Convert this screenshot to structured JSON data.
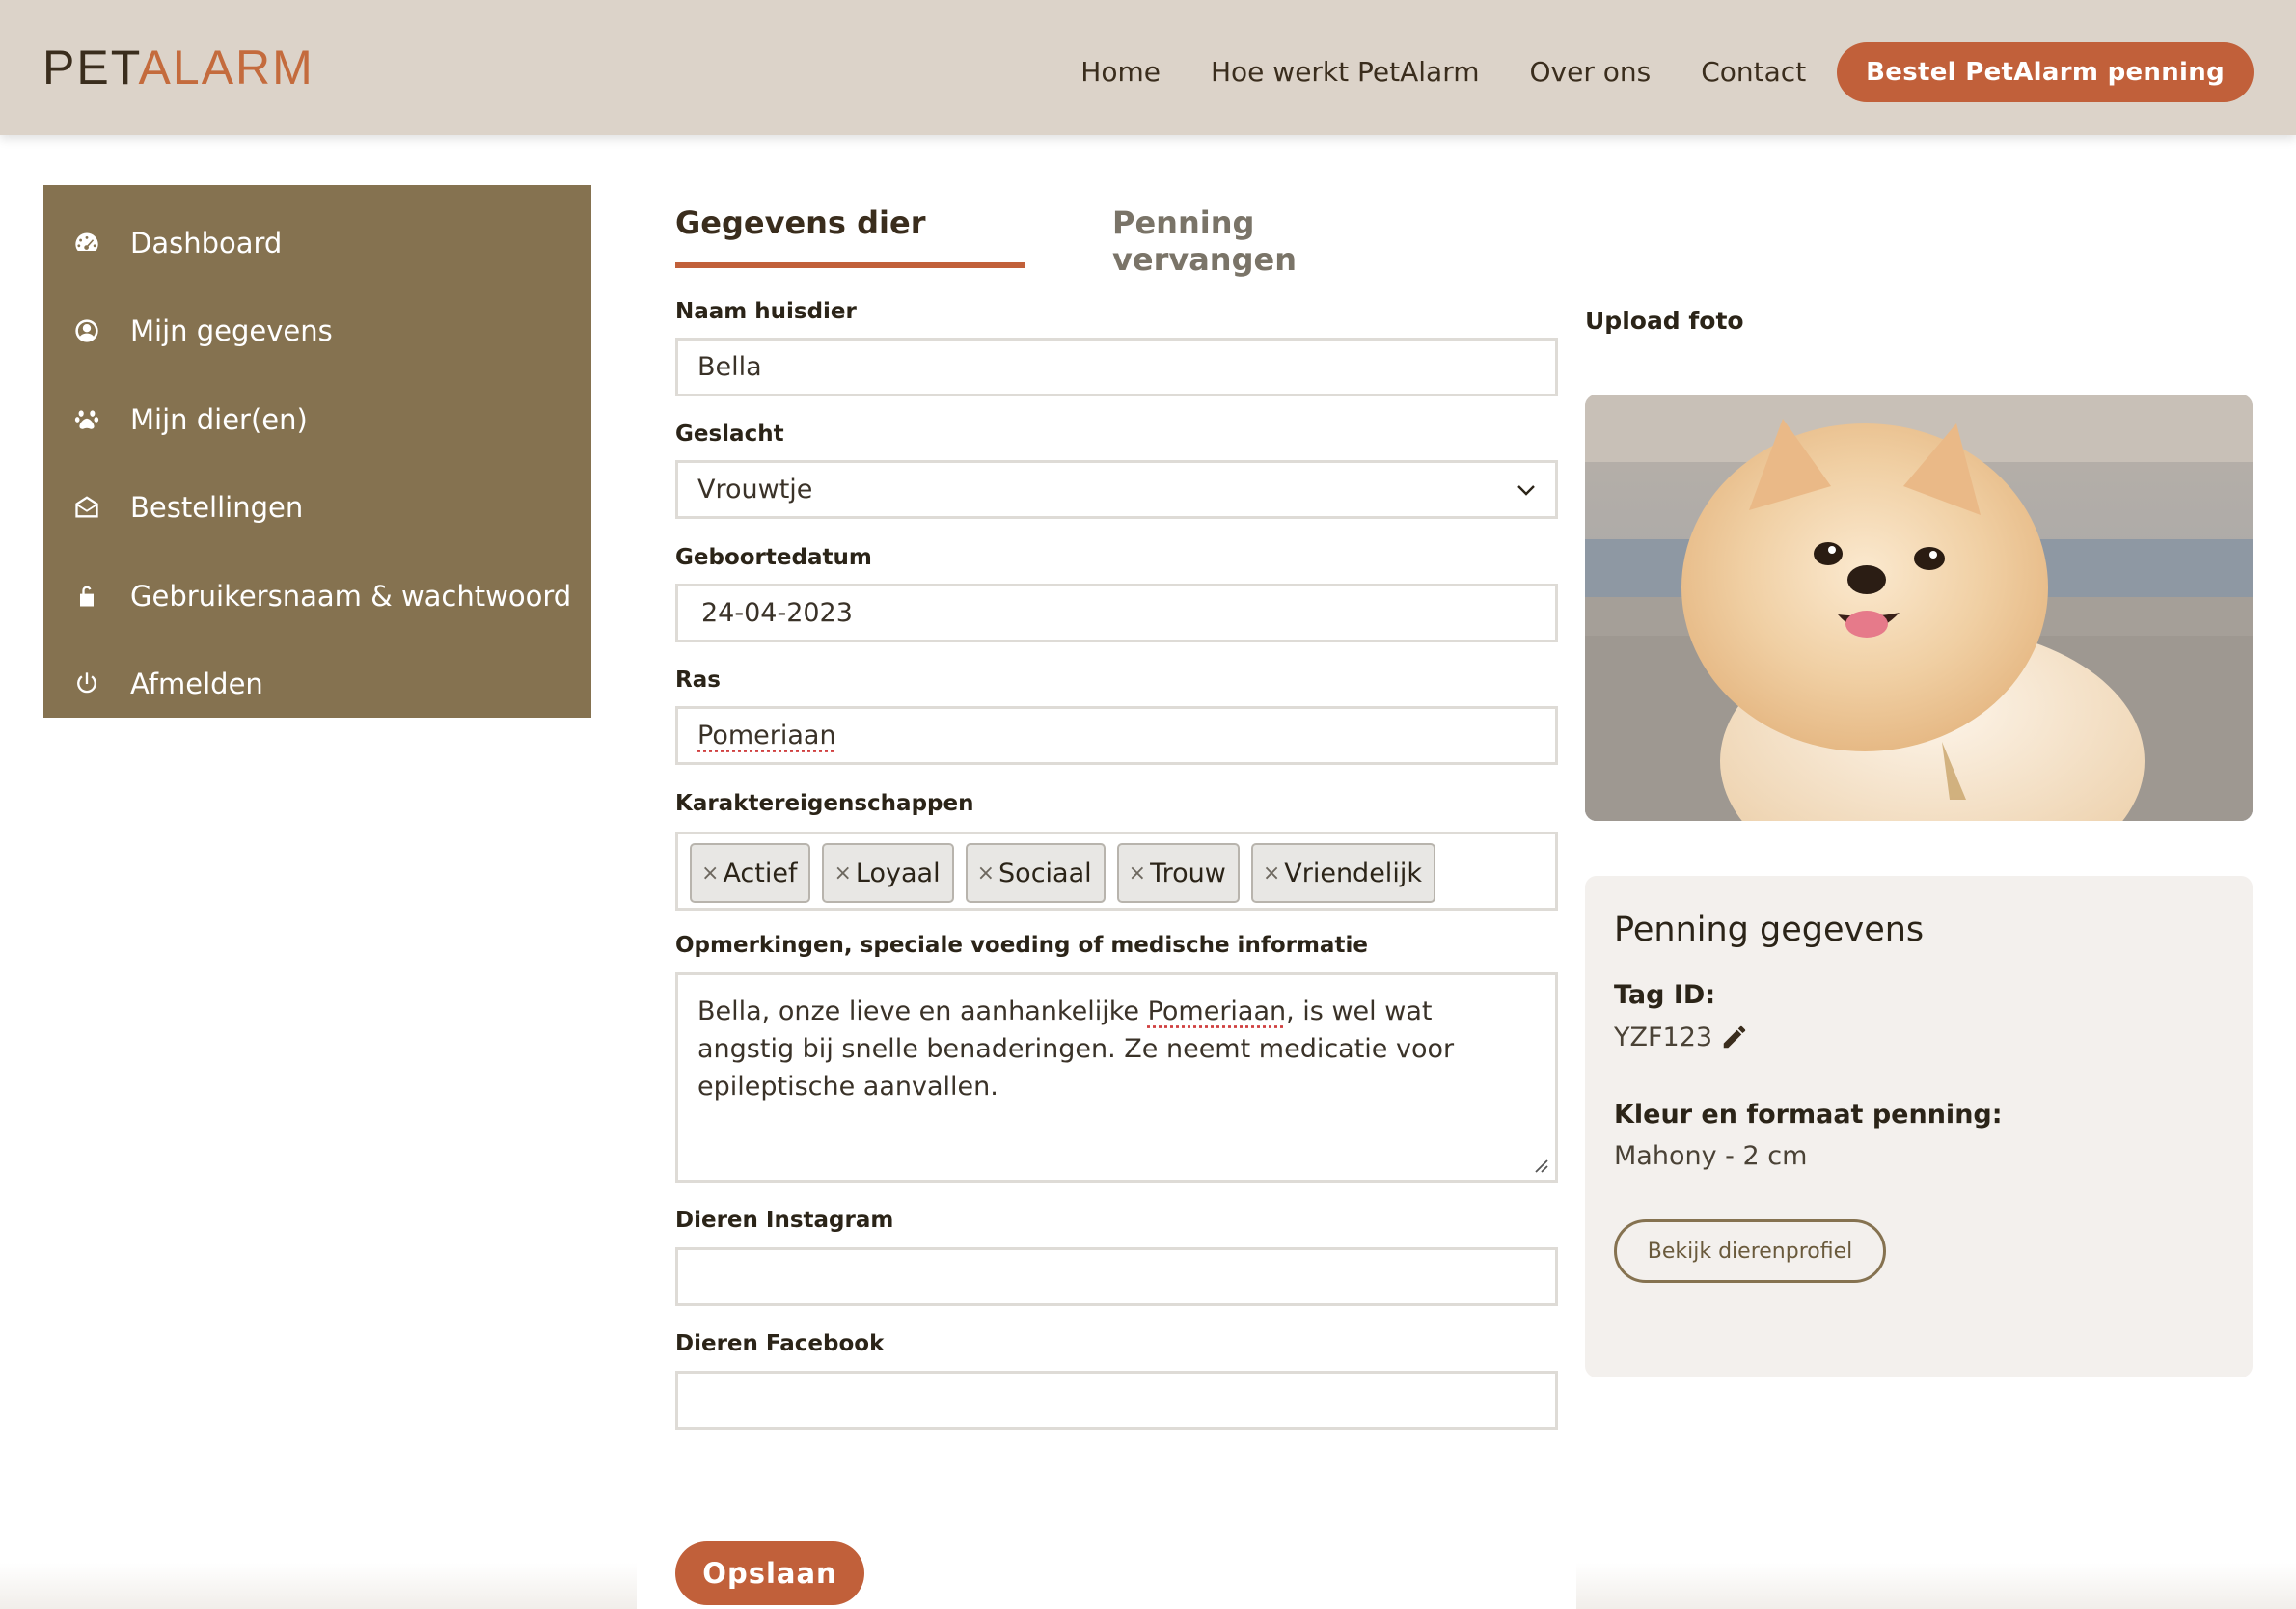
{
  "header": {
    "logo_part1": "PET",
    "logo_part2": "ALARM",
    "nav": [
      "Home",
      "Hoe werkt PetAlarm",
      "Over ons",
      "Contact"
    ],
    "cta": "Bestel PetAlarm penning"
  },
  "sidebar": {
    "items": [
      {
        "label": "Dashboard",
        "icon": "dashboard-gauge-icon"
      },
      {
        "label": "Mijn gegevens",
        "icon": "user-circle-icon"
      },
      {
        "label": "Mijn dier(en)",
        "icon": "paw-icon"
      },
      {
        "label": "Bestellingen",
        "icon": "envelope-open-icon"
      },
      {
        "label": "Gebruikersnaam & wachtwoord",
        "icon": "unlock-icon"
      },
      {
        "label": "Afmelden",
        "icon": "power-icon"
      }
    ]
  },
  "tabs": {
    "active": "Gegevens dier",
    "inactive": "Penning vervangen"
  },
  "form": {
    "name_label": "Naam huisdier",
    "name_value": "Bella",
    "gender_label": "Geslacht",
    "gender_value": "Vrouwtje",
    "birth_label": "Geboortedatum",
    "birth_value": "24-04-2023",
    "breed_label": "Ras",
    "breed_value": "Pomeriaan",
    "traits_label": "Karaktereigenschappen",
    "traits": [
      "Actief",
      "Loyaal",
      "Sociaal",
      "Trouw",
      "Vriendelijk"
    ],
    "tag_remove": "×",
    "notes_label": "Opmerkingen, speciale voeding of medische informatie",
    "notes_part1": "Bella, onze lieve en aanhankelijke ",
    "notes_spell": "Pomeriaan",
    "notes_part2": ", is wel wat angstig bij snelle benaderingen. Ze neemt medicatie voor epileptische aanvallen.",
    "instagram_label": "Dieren Instagram",
    "instagram_value": "",
    "facebook_label": "Dieren Facebook",
    "facebook_value": "",
    "save": "Opslaan"
  },
  "photo": {
    "label": "Upload foto"
  },
  "tag_card": {
    "title": "Penning gegevens",
    "id_label": "Tag ID:",
    "id_value": "YZF123",
    "size_label": "Kleur en formaat penning:",
    "size_value": "Mahony - 2 cm",
    "profile_button": "Bekijk dierenprofiel"
  },
  "colors": {
    "accent": "#c1603a",
    "sidebar": "#857250",
    "header": "#dcd3c9"
  }
}
